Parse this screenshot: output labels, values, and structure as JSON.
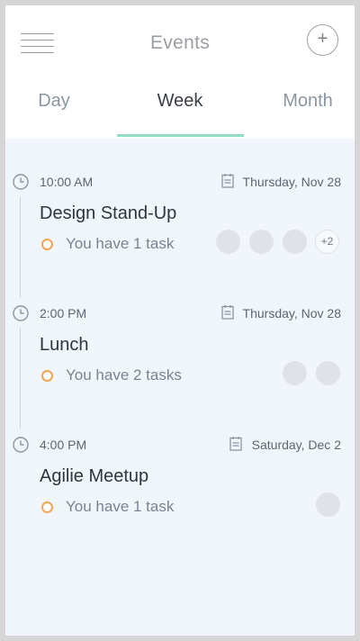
{
  "header": {
    "title": "Events",
    "menu_icon": "hamburger-menu-icon",
    "add_icon": "plus-icon"
  },
  "tabs": [
    {
      "label": "Day",
      "active": false
    },
    {
      "label": "Week",
      "active": true
    },
    {
      "label": "Month",
      "active": false
    }
  ],
  "colors": {
    "accent_indicator": "#8fe0c0",
    "task_dot": "#f3a455",
    "content_bg": "#f0f6fc"
  },
  "events": [
    {
      "time": "10:00 AM",
      "date": "Thursday, Nov 28",
      "title": "Design Stand-Up",
      "tasks": "You have 1 task",
      "attendees": 3,
      "more": "+2"
    },
    {
      "time": "2:00 PM",
      "date": "Thursday, Nov 28",
      "title": "Lunch",
      "tasks": "You have 2 tasks",
      "attendees": 2
    },
    {
      "time": "4:00 PM",
      "date": "Saturday, Dec 2",
      "title": "Agilie Meetup",
      "tasks": "You have 1 task",
      "attendees": 1
    }
  ]
}
